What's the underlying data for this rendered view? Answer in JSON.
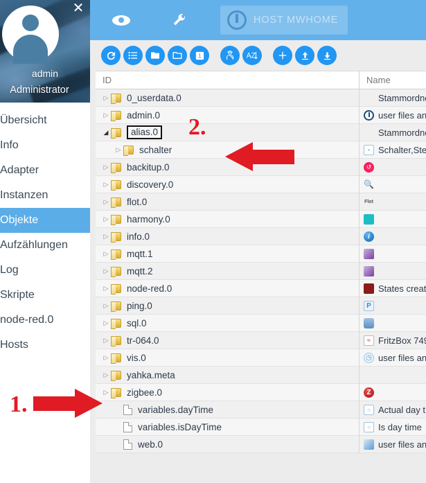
{
  "sidebar": {
    "close_icon": "close-icon",
    "avatar_icon": "user-avatar-icon",
    "user_name": "admin",
    "user_role": "Administrator",
    "items": [
      {
        "label": "Übersicht",
        "active": false
      },
      {
        "label": "Info",
        "active": false
      },
      {
        "label": "Adapter",
        "active": false
      },
      {
        "label": "Instanzen",
        "active": false
      },
      {
        "label": "Objekte",
        "active": true
      },
      {
        "label": "Aufzählungen",
        "active": false
      },
      {
        "label": "Log",
        "active": false
      },
      {
        "label": "Skripte",
        "active": false
      },
      {
        "label": "node-red.0",
        "active": false
      },
      {
        "label": "Hosts",
        "active": false
      }
    ]
  },
  "topbar": {
    "eye_icon": "eye-icon",
    "wrench_icon": "wrench-icon",
    "host_label": "HOST MWHOME",
    "host_logo_icon": "iobroker-power-logo-icon",
    "bg_color": "#63b1ea"
  },
  "toolbar": {
    "buttons": [
      {
        "name": "refresh-button",
        "icon": "refresh-icon"
      },
      {
        "name": "list-view-button",
        "icon": "list-icon"
      },
      {
        "name": "collapse-all-button",
        "icon": "folder-filled-icon"
      },
      {
        "name": "expand-all-button",
        "icon": "folder-outline-icon"
      },
      {
        "name": "expand-one-level-button",
        "icon": "number-one-box-icon"
      },
      {
        "name": "expert-mode-button",
        "icon": "expert-detective-icon"
      },
      {
        "name": "sort-alpha-button",
        "icon": "a-z-sort-icon"
      },
      {
        "name": "add-object-button",
        "icon": "plus-icon"
      },
      {
        "name": "import-button",
        "icon": "upload-arrow-icon"
      },
      {
        "name": "export-button",
        "icon": "download-arrow-icon"
      }
    ],
    "accent_color": "#2196f3"
  },
  "table": {
    "columns": [
      "ID",
      "Name"
    ],
    "rows": [
      {
        "id": "0_userdata.0",
        "indent": 0,
        "type": "folder",
        "expander": "collapsed",
        "boxed": false,
        "name": "Stammordner fü",
        "name_icon": "none"
      },
      {
        "id": "admin.0",
        "indent": 0,
        "type": "folder",
        "expander": "collapsed",
        "boxed": false,
        "name": "user files an",
        "name_icon": "iobroker-icon"
      },
      {
        "id": "alias.0",
        "indent": 0,
        "type": "folder",
        "expander": "expanded",
        "boxed": true,
        "name": "Stammordner fü",
        "name_icon": "none"
      },
      {
        "id": "schalter",
        "indent": 1,
        "type": "folder",
        "expander": "collapsed",
        "boxed": false,
        "name": "Schalter,Ste",
        "name_icon": "channel-icon"
      },
      {
        "id": "backitup.0",
        "indent": 0,
        "type": "folder",
        "expander": "collapsed",
        "boxed": false,
        "name": "",
        "name_icon": "backitup-icon"
      },
      {
        "id": "discovery.0",
        "indent": 0,
        "type": "folder",
        "expander": "collapsed",
        "boxed": false,
        "name": "",
        "name_icon": "binoculars-icon"
      },
      {
        "id": "flot.0",
        "indent": 0,
        "type": "folder",
        "expander": "collapsed",
        "boxed": false,
        "name": "",
        "name_icon": "flot-icon"
      },
      {
        "id": "harmony.0",
        "indent": 0,
        "type": "folder",
        "expander": "collapsed",
        "boxed": false,
        "name": "",
        "name_icon": "harmony-icon"
      },
      {
        "id": "info.0",
        "indent": 0,
        "type": "folder",
        "expander": "collapsed",
        "boxed": false,
        "name": "",
        "name_icon": "info-icon"
      },
      {
        "id": "mqtt.1",
        "indent": 0,
        "type": "folder",
        "expander": "collapsed",
        "boxed": false,
        "name": "",
        "name_icon": "mqtt-icon"
      },
      {
        "id": "mqtt.2",
        "indent": 0,
        "type": "folder",
        "expander": "collapsed",
        "boxed": false,
        "name": "",
        "name_icon": "mqtt-icon"
      },
      {
        "id": "node-red.0",
        "indent": 0,
        "type": "folder",
        "expander": "collapsed",
        "boxed": false,
        "name": "States creat",
        "name_icon": "node-red-icon"
      },
      {
        "id": "ping.0",
        "indent": 0,
        "type": "folder",
        "expander": "collapsed",
        "boxed": false,
        "name": "",
        "name_icon": "ping-icon"
      },
      {
        "id": "sql.0",
        "indent": 0,
        "type": "folder",
        "expander": "collapsed",
        "boxed": false,
        "name": "",
        "name_icon": "database-icon"
      },
      {
        "id": "tr-064.0",
        "indent": 0,
        "type": "folder",
        "expander": "collapsed",
        "boxed": false,
        "name": "FritzBox 749",
        "name_icon": "fritzbox-icon"
      },
      {
        "id": "vis.0",
        "indent": 0,
        "type": "folder",
        "expander": "collapsed",
        "boxed": false,
        "name": "user files an",
        "name_icon": "vis-icon"
      },
      {
        "id": "yahka.meta",
        "indent": 0,
        "type": "folder",
        "expander": "collapsed",
        "boxed": false,
        "name": "",
        "name_icon": "none"
      },
      {
        "id": "zigbee.0",
        "indent": 0,
        "type": "folder",
        "expander": "collapsed",
        "boxed": false,
        "name": "",
        "name_icon": "zigbee-icon"
      },
      {
        "id": "variables.dayTime",
        "indent": 1,
        "type": "doc",
        "expander": "none",
        "boxed": false,
        "name": "Actual day t",
        "name_icon": "state-icon"
      },
      {
        "id": "variables.isDayTime",
        "indent": 1,
        "type": "doc",
        "expander": "none",
        "boxed": false,
        "name": "Is day time",
        "name_icon": "state-icon"
      },
      {
        "id": "web.0",
        "indent": 1,
        "type": "doc",
        "expander": "none",
        "boxed": false,
        "name": "user files an",
        "name_icon": "web-icon"
      }
    ]
  },
  "annotations": {
    "marker_color": "#e01b24",
    "items": [
      {
        "label": "1.",
        "arrow": "arrow-right-icon",
        "target": "variables.dayTime row"
      },
      {
        "label": "2.",
        "arrow": "arrow-left-icon",
        "target": "alias.0 row"
      }
    ]
  }
}
